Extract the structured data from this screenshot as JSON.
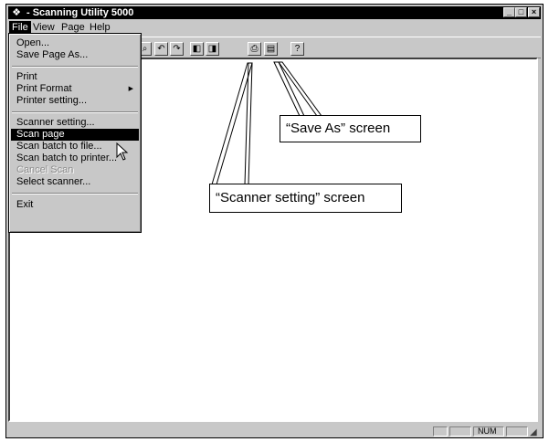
{
  "window": {
    "title": "- Scanning Utility 5000",
    "app_icon": "scanner-app-icon"
  },
  "menubar": [
    "File",
    "View",
    "Page",
    "Help"
  ],
  "file_menu": [
    {
      "label": "Open..."
    },
    {
      "label": "Save Page As..."
    },
    {
      "label": "Print"
    },
    {
      "label": "Print Format",
      "submenu": true
    },
    {
      "label": "Printer setting..."
    },
    {
      "label": "Scanner setting..."
    },
    {
      "label": "Scan page",
      "highlighted": true
    },
    {
      "label": "Scan batch to file..."
    },
    {
      "label": "Scan batch to printer..."
    },
    {
      "label": "Cancel Scan",
      "disabled": true
    },
    {
      "label": "Select scanner..."
    },
    {
      "label": "Exit"
    }
  ],
  "toolbar_icons": [
    "zoom-icon",
    "rotate-left-icon",
    "rotate-right-icon",
    "page-previous-icon",
    "page-next-icon",
    "scanner-setting-icon",
    "save-as-icon",
    "help-icon"
  ],
  "statusbar": {
    "num": "NUM"
  },
  "callouts": {
    "save_as": "“Save As” screen",
    "scanner_setting": "“Scanner setting” screen"
  },
  "colors": {
    "titlebar": "#000000",
    "face": "#c8c8c8",
    "highlight": "#000000"
  }
}
